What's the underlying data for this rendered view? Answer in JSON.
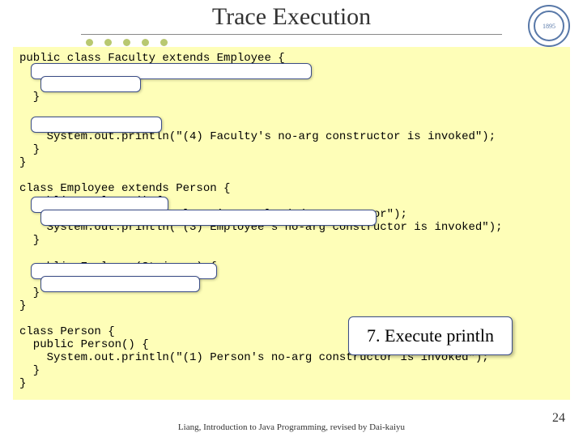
{
  "title": "Trace Execution",
  "logo_year": "1895",
  "code": "public class Faculty extends Employee {\n  public static void main(String[] args) {\n    new Faculty();\n  }\n\n  public Faculty() {\n    System.out.println(\"(4) Faculty's no-arg constructor is invoked\");\n  }\n}\n\nclass Employee extends Person {\n  public Employee() {\n    this(\"(2) Invoke Employee's overloaded constructor\");\n    System.out.println(\"(3) Employee's no-arg constructor is invoked\");\n  }\n\n  public Employee(String s) {\n    System.out.println(s);\n  }\n}\n\nclass Person {\n  public Person() {\n    System.out.println(\"(1) Person's no-arg constructor is invoked\");\n  }\n}",
  "callout": "7. Execute println",
  "footer": "Liang, Introduction to Java Programming, revised by Dai-kaiyu",
  "page_number": "24"
}
